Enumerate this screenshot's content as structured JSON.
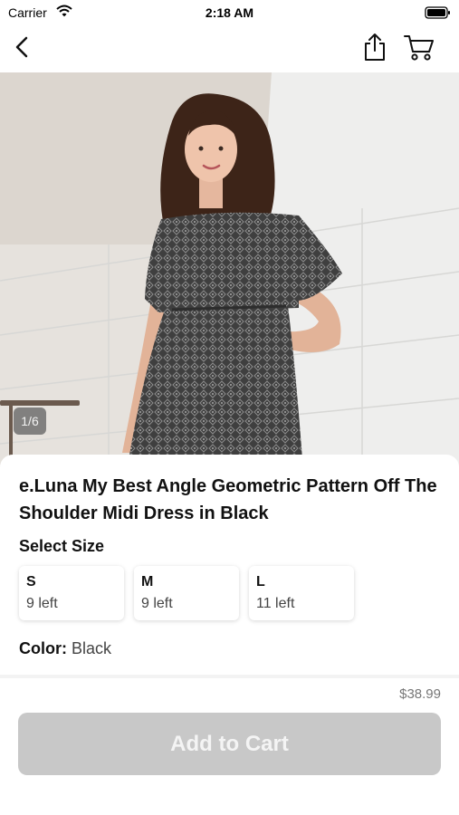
{
  "status_bar": {
    "carrier": "Carrier",
    "time": "2:18 AM",
    "icons": [
      "wifi-icon",
      "battery-icon"
    ]
  },
  "nav": {
    "icons": [
      "back-chevron-icon",
      "share-icon",
      "cart-icon"
    ]
  },
  "gallery": {
    "page_indicator": "1/6"
  },
  "product": {
    "title": "e.Luna My Best Angle Geometric Pattern Off The Shoulder Midi Dress in Black",
    "size_heading": "Select Size",
    "sizes": [
      {
        "label": "S",
        "stock": "9 left"
      },
      {
        "label": "M",
        "stock": "9 left"
      },
      {
        "label": "L",
        "stock": "11 left"
      }
    ],
    "color_label": "Color:",
    "color_value": "Black"
  },
  "purchase": {
    "price": "$38.99",
    "button_label": "Add to Cart",
    "button_color": "#c8c8c8"
  }
}
